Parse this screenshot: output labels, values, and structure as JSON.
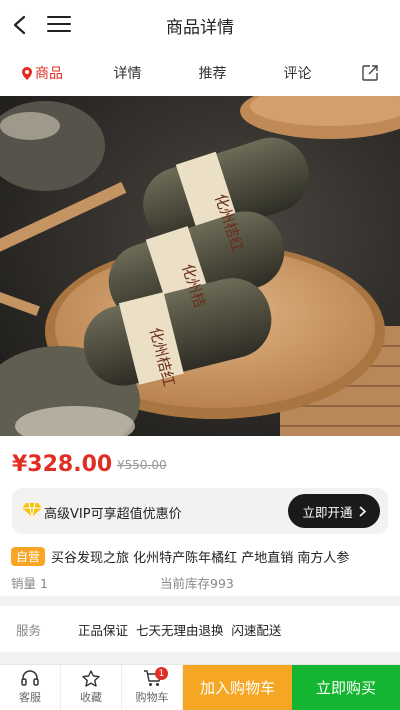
{
  "header": {
    "title": "商品详情"
  },
  "tabs": [
    {
      "label": "商品",
      "active": true
    },
    {
      "label": "详情",
      "active": false
    },
    {
      "label": "推荐",
      "active": false
    },
    {
      "label": "评论",
      "active": false
    }
  ],
  "product": {
    "price": "¥328.00",
    "original_price": "¥550.00",
    "tag": "自营",
    "name": "买谷发现之旅 化州特产陈年橘红 产地直销 南方人参",
    "sales": "销量 1",
    "stock": "当前库存993",
    "image_labels": [
      "化州桔红",
      "化州桔",
      "化州桔红"
    ]
  },
  "vip": {
    "text": "高级VIP可享超值优惠价",
    "button": "立即开通"
  },
  "service": {
    "label": "服务",
    "value": "正品保证  七天无理由退换  闪速配送"
  },
  "bottom_bar": {
    "service_label": "客服",
    "favorite_label": "收藏",
    "cart_label": "购物车",
    "cart_count": "1",
    "add_cart": "加入购物车",
    "buy_now": "立即购买"
  },
  "colors": {
    "accent": "#e02e24",
    "add_cart": "#f5a623",
    "buy": "#14b530",
    "tag": "#f7a525"
  }
}
